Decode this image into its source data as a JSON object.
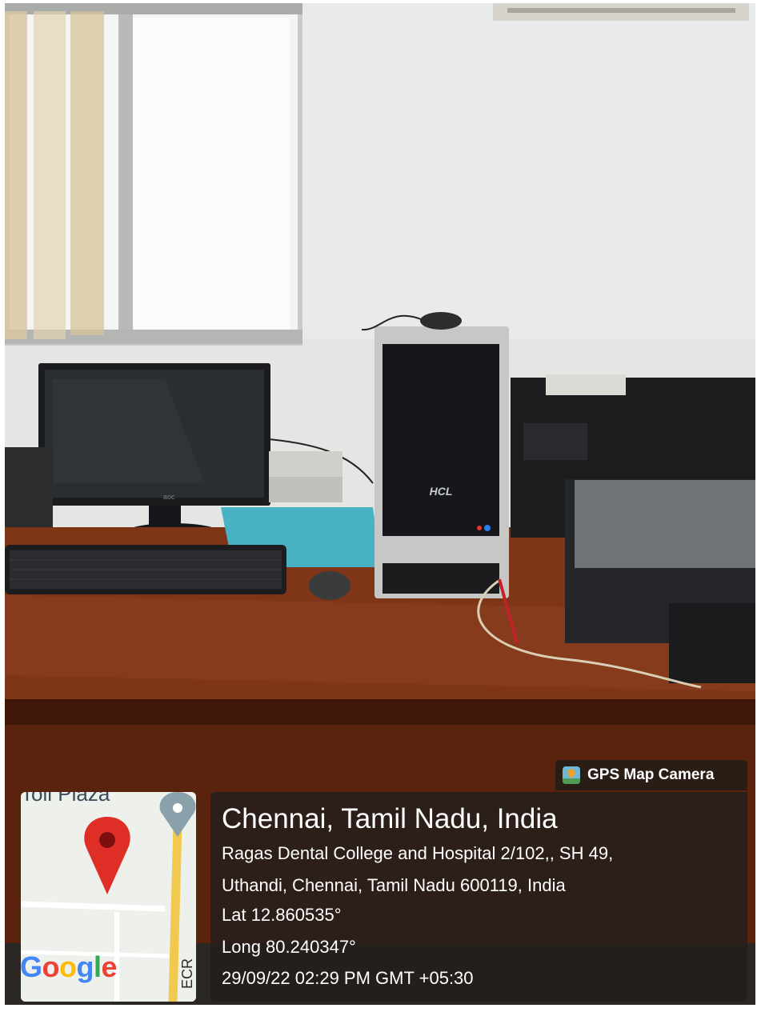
{
  "gps_badge": {
    "label": "GPS Map Camera",
    "icon": "map-app-icon"
  },
  "map": {
    "road_label": "ECR",
    "place_label": "Toll Plaza",
    "logo_text": "Google",
    "marker_icon": "location-pin-icon",
    "road_marker_icon": "map-pin-icon"
  },
  "location": {
    "city_line": "Chennai, Tamil Nadu, India",
    "address_line1": "Ragas Dental College and Hospital 2/102,, SH 49,",
    "address_line2": "Uthandi, Chennai, Tamil Nadu 600119, India",
    "latitude": "Lat 12.860535°",
    "longitude": "Long 80.240347°",
    "timestamp": "29/09/22 02:29 PM GMT +05:30"
  },
  "scene": {
    "cpu_brand": "HCL",
    "monitor_brand": "AOC",
    "colors": {
      "wall": "#e3e5e3",
      "desk": "#7a3316",
      "desk_edge": "#4a1b0b"
    }
  }
}
